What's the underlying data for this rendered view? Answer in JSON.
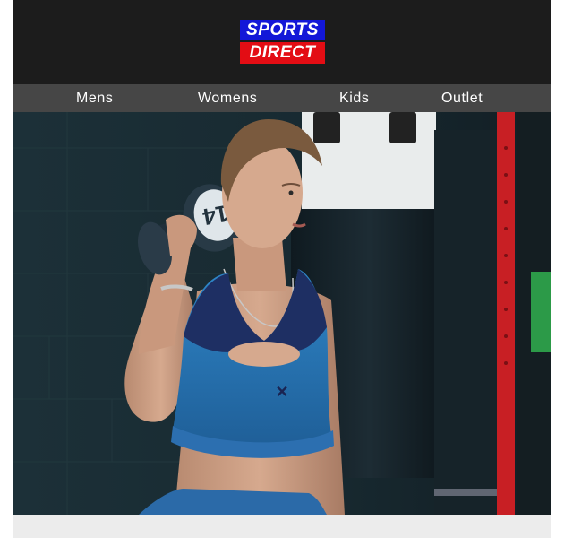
{
  "brand": {
    "logo_top": "SPORTS",
    "logo_bottom": "DIRECT",
    "colors": {
      "top": "#1317d8",
      "bottom": "#e30d14",
      "header_bg": "#1c1c1c",
      "nav_bg": "#464646"
    }
  },
  "nav": {
    "items": [
      {
        "label": "Mens"
      },
      {
        "label": "Womens"
      },
      {
        "label": "Kids"
      },
      {
        "label": "Outlet"
      }
    ]
  },
  "hero": {
    "dumbbell_number": "14"
  }
}
